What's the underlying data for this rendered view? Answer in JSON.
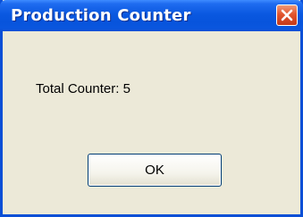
{
  "window": {
    "title": "Production Counter",
    "accent_color": "#0A58E0",
    "close_icon": "close-icon"
  },
  "dialog": {
    "message_label": "Total Counter:",
    "message_value": "5",
    "ok_label": "OK"
  }
}
